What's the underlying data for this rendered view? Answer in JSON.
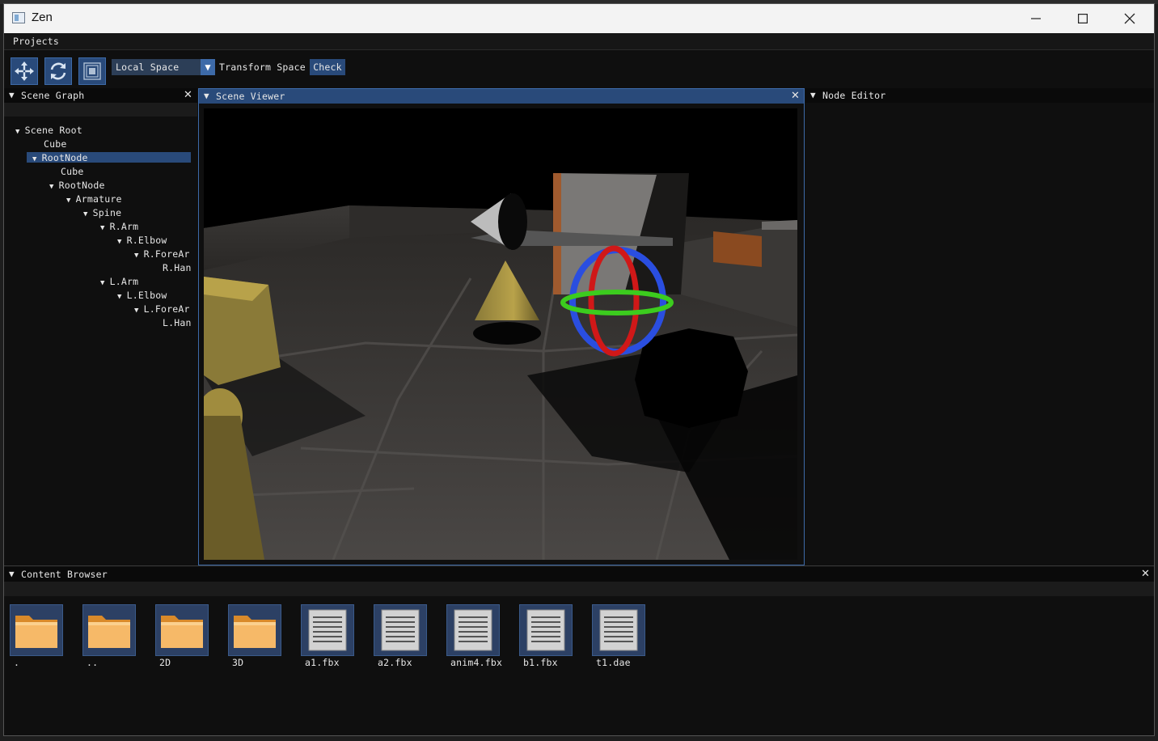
{
  "window": {
    "title": "Zen"
  },
  "menubar": {
    "projects": "Projects"
  },
  "toolbar": {
    "buttons": [
      "Translate",
      "Rotate",
      "Scale"
    ],
    "space_combo": "Local Space",
    "transform_label": "Transform Space",
    "check_button": "Check"
  },
  "scene_graph": {
    "title": "Scene Graph",
    "nodes": [
      "Scene Root",
      "Cube",
      "RootNode",
      "Cube",
      "RootNode",
      "Armature",
      "Spine",
      "R.Arm",
      "R.Elbow",
      "R.ForeAr",
      "R.Han",
      "L.Arm",
      "L.Elbow",
      "L.ForeAr",
      "L.Han"
    ]
  },
  "scene_viewer": {
    "title": "Scene Viewer"
  },
  "node_editor": {
    "title": "Node Editor"
  },
  "content_browser": {
    "title": "Content Browser",
    "items": [
      {
        "label": ".",
        "kind": "folder"
      },
      {
        "label": "..",
        "kind": "folder"
      },
      {
        "label": "2D",
        "kind": "folder"
      },
      {
        "label": "3D",
        "kind": "folder"
      },
      {
        "label": "a1.fbx",
        "kind": "file"
      },
      {
        "label": "a2.fbx",
        "kind": "file"
      },
      {
        "label": "anim4.fbx",
        "kind": "file"
      },
      {
        "label": "b1.fbx",
        "kind": "file"
      },
      {
        "label": "t1.dae",
        "kind": "file"
      }
    ]
  },
  "colors": {
    "accent": "#294a7a",
    "accent_light": "#3d6aa8",
    "panel_bg": "#0f0f0f",
    "text": "#e6e6e6"
  }
}
